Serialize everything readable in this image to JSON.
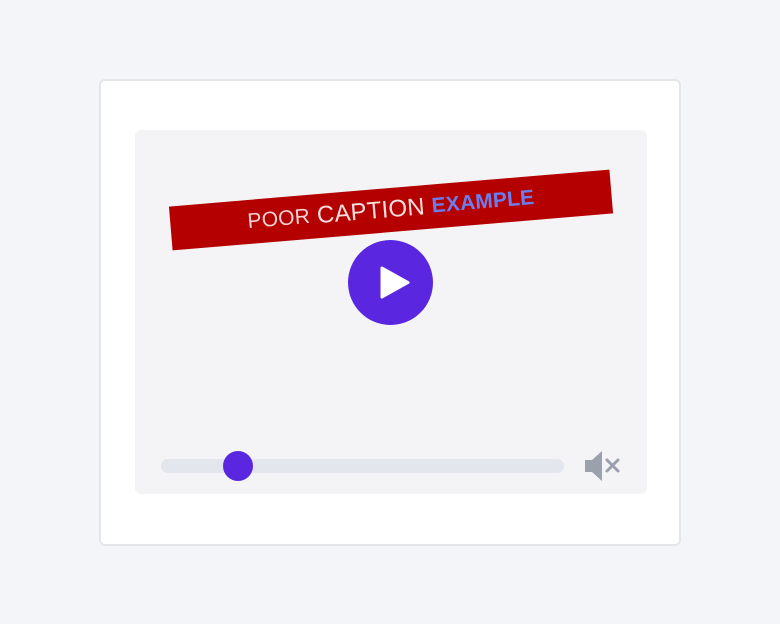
{
  "caption": {
    "words": [
      "POOR",
      "CAPTION",
      "EXAMPLE"
    ]
  },
  "player": {
    "progress_fraction": 0.19,
    "muted": true
  },
  "icons": {
    "play": "play-icon",
    "volume": "volume-muted-icon"
  },
  "colors": {
    "page_background": "#f4f5f9",
    "player_background": "#f4f4f7",
    "accent": "#5b26df",
    "caption_background": "#b50000",
    "caption_highlight": "#6b7df0",
    "track": "#e3e6ec",
    "icon_gray": "#9aa1ad"
  }
}
